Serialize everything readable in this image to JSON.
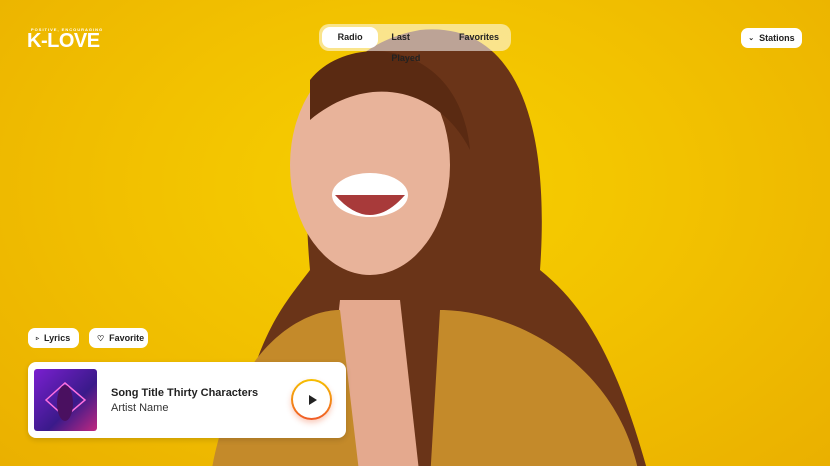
{
  "logo": {
    "tagline": "POSITIVE, ENCOURAGING",
    "name": "K-LOVE"
  },
  "nav": {
    "tabs": [
      {
        "label": "Radio",
        "active": true
      },
      {
        "label": "Last Played"
      },
      {
        "label": "Favorites"
      }
    ]
  },
  "stations": {
    "label": "Stations",
    "icon": "chevron-down-icon"
  },
  "actions": {
    "lyrics": "Lyrics",
    "favorite": "Favorite"
  },
  "player": {
    "title": "Song Title Thirty Characters",
    "artist": "Artist Name",
    "play_icon": "play-icon"
  },
  "colors": {
    "background": "#f2c200",
    "play_gradient_start": "#f6c000",
    "play_gradient_end": "#f05a28"
  }
}
